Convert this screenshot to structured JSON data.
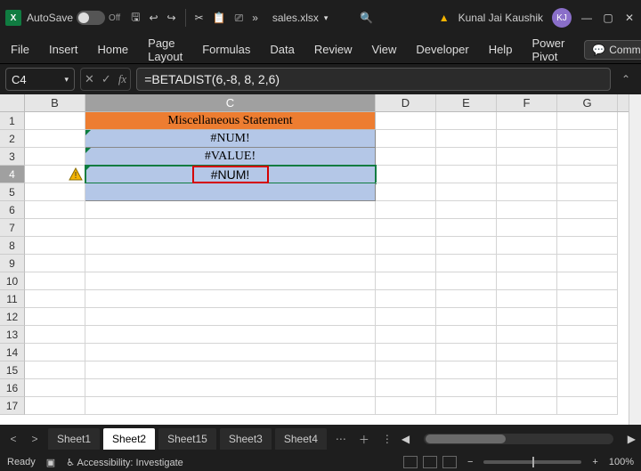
{
  "titlebar": {
    "autosave_label": "AutoSave",
    "autosave_state": "Off",
    "filename": "sales.xlsx",
    "user_name": "Kunal Jai Kaushik",
    "user_initials": "KJ"
  },
  "ribbon": {
    "tabs": [
      "File",
      "Insert",
      "Home",
      "Page Layout",
      "Formulas",
      "Data",
      "Review",
      "View",
      "Developer",
      "Help",
      "Power Pivot"
    ],
    "comments_label": "Comments"
  },
  "formulabar": {
    "namebox": "C4",
    "formula": "=BETADIST(6,-8, 8, 2,6)"
  },
  "columns": {
    "B": "B",
    "C": "C",
    "D": "D",
    "E": "E",
    "F": "F",
    "G": "G"
  },
  "cells": {
    "C1": "Miscellaneous Statement",
    "C2": "#NUM!",
    "C3": "#VALUE!",
    "C4": "#NUM!"
  },
  "sheets": {
    "tabs": [
      "Sheet1",
      "Sheet2",
      "Sheet15",
      "Sheet3",
      "Sheet4"
    ],
    "active_index": 1
  },
  "statusbar": {
    "ready": "Ready",
    "accessibility": "Accessibility: Investigate",
    "zoom": "100%"
  }
}
